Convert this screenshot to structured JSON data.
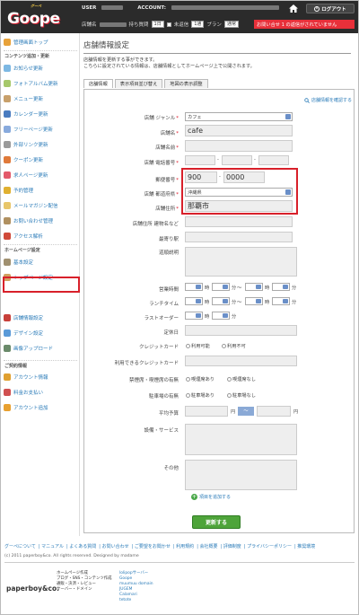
{
  "header": {
    "logo_badge": "グーペ",
    "logo_text": "Goope",
    "user_label": "USER",
    "account_label": "ACCOUNT:",
    "store_label": "店舗名",
    "points_label": "持ち質問",
    "points_value": "1日",
    "unread_label": "未返信",
    "unread_value": "1通",
    "plan_label": "プラン",
    "plan_value": "通常",
    "logout": "ログアウト",
    "alert": "お問い合せ 1 の返信がされていません"
  },
  "sidebar": {
    "items": [
      {
        "label": "管理画面トップ",
        "color": "#e8a23a"
      },
      {
        "label": "お知らせ更新",
        "color": "#7db8e3"
      },
      {
        "label": "フォトアルバム更新",
        "color": "#a6c86b"
      },
      {
        "label": "メニュー更新",
        "color": "#c8a06b"
      },
      {
        "label": "カレンダー更新",
        "color": "#4a7cc0"
      },
      {
        "label": "フリーページ更新",
        "color": "#88aadd"
      },
      {
        "label": "外部リンク更新",
        "color": "#9a9a9a"
      },
      {
        "label": "クーポン更新",
        "color": "#e07a3a"
      },
      {
        "label": "求人ページ更新",
        "color": "#e35a6a"
      },
      {
        "label": "予約管理",
        "color": "#e0b030"
      },
      {
        "label": "メールマガジン配信",
        "color": "#e8c66a"
      },
      {
        "label": "お問い合わせ管理",
        "color": "#b09060"
      },
      {
        "label": "アクセス解析",
        "color": "#d04a3a"
      },
      {
        "label": "基本設定",
        "color": "#a09070"
      },
      {
        "label": "トップページ設定",
        "color": "#d0a060"
      },
      {
        "label": "店舗情報設定",
        "color": "#c8403a"
      },
      {
        "label": "デザイン設定",
        "color": "#5a9ad8"
      },
      {
        "label": "画像アップロード",
        "color": "#6a8a6a"
      },
      {
        "label": "アカウント情報",
        "color": "#e0a030"
      },
      {
        "label": "料金お支払い",
        "color": "#d05050"
      },
      {
        "label": "アカウント追加",
        "color": "#e8a030"
      }
    ],
    "section_content": "コンテンツ追加・更新",
    "section_page": "ホームページ設定",
    "section_account": "ご契約情報"
  },
  "main": {
    "title": "店舗情報設定",
    "intro_1": "店舗情報を更新する事ができます。",
    "intro_2": "こちらに設定されている情報は、店舗情報としてホームページ上で公開されます。",
    "tabs": [
      "店舗情報",
      "表示項目並び替え",
      "地図の表示調整"
    ],
    "confirm_link": "店舗情報を確認する",
    "labels": {
      "genre": "店舗 ジャンル",
      "name": "店舗名",
      "name_kana": "店舗名前",
      "phone": "店舗 電話番号",
      "postal": "郵便番号",
      "prefecture": "店舗 都道府県",
      "address": "店舗住所",
      "building": "店舗住所 建物名など",
      "station": "最寄り駅",
      "directions": "道順説明",
      "hours": "営業時間",
      "lunch": "ランチタイム",
      "last_order": "ラストオーダー",
      "holiday": "定休日",
      "credit": "クレジットカード",
      "credit_usable": "利用できるクレジットカード",
      "smoking": "禁煙席・喫煙席の有無",
      "parking": "駐車場の有無",
      "budget": "平均予算",
      "facilities": "設備・サービス",
      "other": "その他"
    },
    "values": {
      "genre": "カフェ",
      "name": "cafe",
      "postal_1": "900",
      "postal_2": "0000",
      "prefecture": "沖縄県",
      "address": "那覇市"
    },
    "time_unit_hour": "時",
    "time_unit_min": "分",
    "time_range": "〜",
    "credit_yes": "利用可能",
    "credit_no": "利用不可",
    "smoking_yes": "喫煙席あり",
    "smoking_no": "喫煙席なし",
    "parking_yes": "駐車場あり",
    "parking_no": "駐車場なし",
    "yen": "円",
    "add_item": "項目を追加する",
    "update": "更新する"
  },
  "footer": {
    "links": [
      "グーペについて",
      "マニュアル",
      "よくある質問",
      "お問い合わせ",
      "ご要望をお聞かせ",
      "利用規約",
      "会社概要",
      "評価制度",
      "プライバシーポリシー",
      "推奨環境"
    ],
    "copyright": "(c) 2011 paperboy&co. All rights reserved. Designed by madame",
    "logo": "paperboy&co.",
    "col1": [
      "ホームページ作成",
      "ブログ・SNS・コンテンツ作成",
      "通販・決済・レビュー",
      "サーバー・ドメイン"
    ],
    "col2": [
      "lolipopサーバー",
      "Goope",
      "muumuu domain",
      "JUGEM",
      "Calamari",
      "tetote"
    ]
  }
}
